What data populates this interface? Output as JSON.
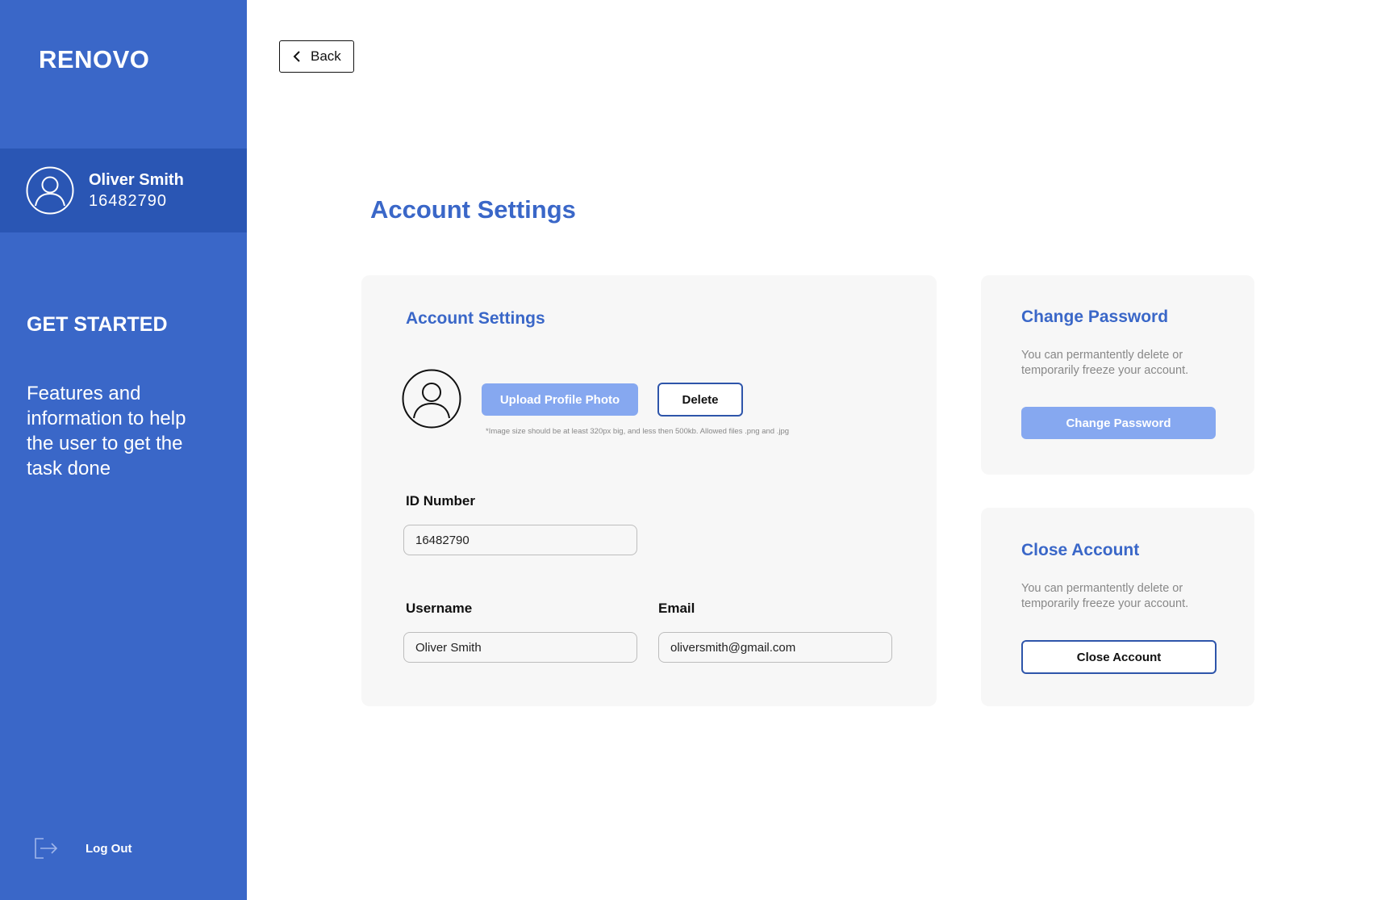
{
  "sidebar": {
    "logo": "RENOVO",
    "user": {
      "name": "Oliver Smith",
      "id": "16482790"
    },
    "get_started_title": "GET STARTED",
    "get_started_text": "Features and information to help the user to get the task done",
    "logout_label": "Log Out"
  },
  "header": {
    "back_label": "Back",
    "page_title": "Account Settings"
  },
  "account_card": {
    "title": "Account Settings",
    "upload_label": "Upload Profile Photo",
    "delete_label": "Delete",
    "image_hint": "*Image size should be at least 320px big, and less then 500kb. Allowed files .png and .jpg",
    "id_label": "ID Number",
    "id_value": "16482790",
    "username_label": "Username",
    "username_value": "Oliver Smith",
    "email_label": "Email",
    "email_value": "oliversmith@gmail.com"
  },
  "password_card": {
    "title": "Change Password",
    "description": "You can permantently delete or temporarily freeze your account.",
    "button_label": "Change Password"
  },
  "close_card": {
    "title": "Close Account",
    "description": "You can permantently delete or temporarily freeze your account.",
    "button_label": "Close Account"
  },
  "colors": {
    "sidebar": "#3A67C8",
    "profile_band": "#2A56B4",
    "accent": "#3A67C8",
    "primary_button": "#86A8F0",
    "card_bg": "#F7F7F7"
  },
  "icons": {
    "user": "user-circle-icon",
    "logout": "logout-icon",
    "back": "chevron-left-icon"
  }
}
